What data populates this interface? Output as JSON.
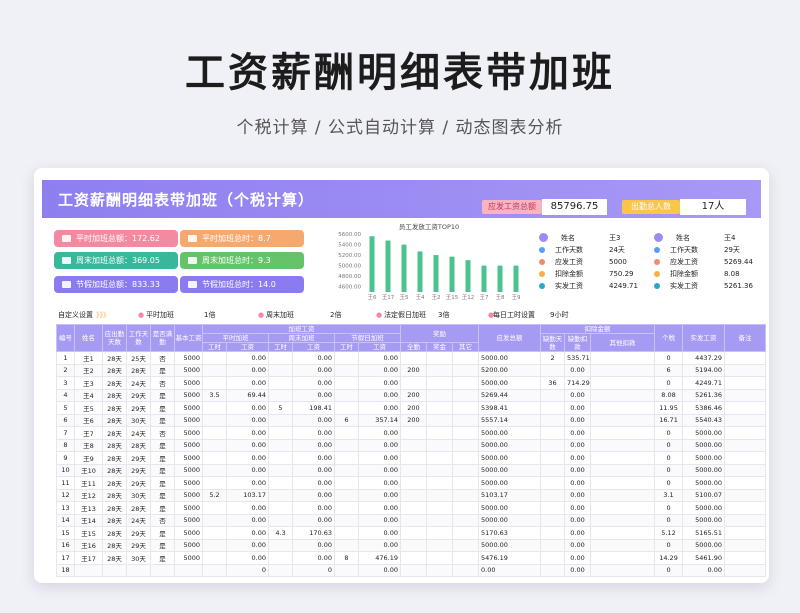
{
  "hero": {
    "title": "工资薪酬明细表带加班",
    "subtitle": "个税计算 /  公式自动计算  /  动态图表分析"
  },
  "sheet": {
    "title": "工资薪酬明细表带加班（个税计算）",
    "total_label": "应发工资总额",
    "total_value": "85796.75",
    "count_label": "出勤总人数",
    "count_value": "17人"
  },
  "kpis": [
    {
      "label": "平时加班总额：172.62",
      "color": "#f48aa0"
    },
    {
      "label": "平时加班总时：8.7",
      "color": "#f6a96f"
    },
    {
      "label": "周末加班总额：369.05",
      "color": "#37b89a"
    },
    {
      "label": "周末加班总时：9.3",
      "color": "#66c36a"
    },
    {
      "label": "节假加班总额：833.33",
      "color": "#8a7cf0"
    },
    {
      "label": "节假加班总时：14.0",
      "color": "#8a7cf0"
    }
  ],
  "chart_data": {
    "type": "bar",
    "title": "员工发放工资TOP10",
    "categories": [
      "王6",
      "王17",
      "王5",
      "王4",
      "王2",
      "王15",
      "王12",
      "王7",
      "王8",
      "王9"
    ],
    "values": [
      5557.14,
      5476.19,
      5398.41,
      5269.44,
      5200.0,
      5170.63,
      5103.17,
      5000,
      5000,
      5000
    ],
    "ylim": [
      4500,
      5600
    ],
    "yticks": [
      "5600.00",
      "5400.00",
      "5200.00",
      "5000.00",
      "4800.00",
      "4600.00"
    ],
    "color": "#4cc38f"
  },
  "emp_left": {
    "name_label": "姓名",
    "name": "王3",
    "rows": [
      {
        "k": "工作天数",
        "v": "24天",
        "c": "#5b9ef7"
      },
      {
        "k": "应发工资",
        "v": "5000",
        "c": "#f48a6a"
      },
      {
        "k": "扣除金额",
        "v": "750.29",
        "c": "#f6b04a"
      },
      {
        "k": "实发工资",
        "v": "4249.71",
        "c": "#2aa7c9"
      }
    ]
  },
  "emp_right": {
    "name_label": "姓名",
    "name": "王4",
    "rows": [
      {
        "k": "工作天数",
        "v": "29天",
        "c": "#5b9ef7"
      },
      {
        "k": "应发工资",
        "v": "5269.44",
        "c": "#f48a6a"
      },
      {
        "k": "扣除金额",
        "v": "8.08",
        "c": "#f6b04a"
      },
      {
        "k": "实发工资",
        "v": "5261.36",
        "c": "#2aa7c9"
      }
    ]
  },
  "settings": {
    "label": "自定义设置",
    "arrows": "》》》",
    "weekday": "平时加班",
    "weekday_v": "1倍",
    "weekend": "周末加班",
    "weekend_v": "2倍",
    "holiday": "法定假日加班",
    "holiday_v": "3倍",
    "hours": "每日工时设置",
    "hours_v": "9小时"
  },
  "headers": {
    "no": "编号",
    "name": "姓名",
    "due": "应出勤天数",
    "work": "工作天数",
    "full": "是否满勤",
    "base": "基本工资",
    "ot": "加班工资",
    "ot_w": "平时加班",
    "ot_e": "周末加班",
    "ot_h": "节假日加班",
    "hours": "工时",
    "pay": "工资",
    "bonus": "奖励",
    "b1": "全勤",
    "b2": "奖金",
    "b3": "其它",
    "gross": "应发总额",
    "ded": "扣除金额",
    "d1": "缺勤天数",
    "d2": "缺勤扣款",
    "d3": "其他扣款",
    "tax": "个税",
    "net": "实发工资",
    "note": "备注"
  },
  "rows": [
    [
      "1",
      "王1",
      "28天",
      "25天",
      "否",
      "5000",
      "",
      "0.00",
      "",
      "0.00",
      "",
      "0.00",
      "",
      "",
      "",
      "5000.00",
      "2",
      "535.71",
      "",
      "0",
      "4437.29",
      ""
    ],
    [
      "2",
      "王2",
      "28天",
      "28天",
      "是",
      "5000",
      "",
      "0.00",
      "",
      "0.00",
      "",
      "0.00",
      "200",
      "",
      "",
      "5200.00",
      "",
      "0.00",
      "",
      "6",
      "5194.00",
      ""
    ],
    [
      "3",
      "王3",
      "28天",
      "24天",
      "否",
      "5000",
      "",
      "0.00",
      "",
      "0.00",
      "",
      "0.00",
      "",
      "",
      "",
      "5000.00",
      "36",
      "714.29",
      "",
      "0",
      "4249.71",
      ""
    ],
    [
      "4",
      "王4",
      "28天",
      "29天",
      "是",
      "5000",
      "3.5",
      "69.44",
      "",
      "0.00",
      "",
      "0.00",
      "200",
      "",
      "",
      "5269.44",
      "",
      "0.00",
      "",
      "8.08",
      "5261.36",
      ""
    ],
    [
      "5",
      "王5",
      "28天",
      "29天",
      "是",
      "5000",
      "",
      "0.00",
      "5",
      "198.41",
      "",
      "0.00",
      "200",
      "",
      "",
      "5398.41",
      "",
      "0.00",
      "",
      "11.95",
      "5386.46",
      ""
    ],
    [
      "6",
      "王6",
      "28天",
      "30天",
      "是",
      "5000",
      "",
      "0.00",
      "",
      "0.00",
      "6",
      "357.14",
      "200",
      "",
      "",
      "5557.14",
      "",
      "0.00",
      "",
      "16.71",
      "5540.43",
      ""
    ],
    [
      "7",
      "王7",
      "28天",
      "24天",
      "否",
      "5000",
      "",
      "0.00",
      "",
      "0.00",
      "",
      "0.00",
      "",
      "",
      "",
      "5000.00",
      "",
      "0.00",
      "",
      "0",
      "5000.00",
      ""
    ],
    [
      "8",
      "王8",
      "28天",
      "28天",
      "是",
      "5000",
      "",
      "0.00",
      "",
      "0.00",
      "",
      "0.00",
      "",
      "",
      "",
      "5000.00",
      "",
      "0.00",
      "",
      "0",
      "5000.00",
      ""
    ],
    [
      "9",
      "王9",
      "28天",
      "29天",
      "是",
      "5000",
      "",
      "0.00",
      "",
      "0.00",
      "",
      "0.00",
      "",
      "",
      "",
      "5000.00",
      "",
      "0.00",
      "",
      "0",
      "5000.00",
      ""
    ],
    [
      "10",
      "王10",
      "28天",
      "29天",
      "是",
      "5000",
      "",
      "0.00",
      "",
      "0.00",
      "",
      "0.00",
      "",
      "",
      "",
      "5000.00",
      "",
      "0.00",
      "",
      "0",
      "5000.00",
      ""
    ],
    [
      "11",
      "王11",
      "28天",
      "29天",
      "是",
      "5000",
      "",
      "0.00",
      "",
      "0.00",
      "",
      "0.00",
      "",
      "",
      "",
      "5000.00",
      "",
      "0.00",
      "",
      "0",
      "5000.00",
      ""
    ],
    [
      "12",
      "王12",
      "28天",
      "30天",
      "是",
      "5000",
      "5.2",
      "103.17",
      "",
      "0.00",
      "",
      "0.00",
      "",
      "",
      "",
      "5103.17",
      "",
      "0.00",
      "",
      "3.1",
      "5100.07",
      ""
    ],
    [
      "13",
      "王13",
      "28天",
      "28天",
      "是",
      "5000",
      "",
      "0.00",
      "",
      "0.00",
      "",
      "0.00",
      "",
      "",
      "",
      "5000.00",
      "",
      "0.00",
      "",
      "0",
      "5000.00",
      ""
    ],
    [
      "14",
      "王14",
      "28天",
      "24天",
      "否",
      "5000",
      "",
      "0.00",
      "",
      "0.00",
      "",
      "0.00",
      "",
      "",
      "",
      "5000.00",
      "",
      "0.00",
      "",
      "0",
      "5000.00",
      ""
    ],
    [
      "15",
      "王15",
      "28天",
      "29天",
      "是",
      "5000",
      "",
      "0.00",
      "4.3",
      "170.63",
      "",
      "0.00",
      "",
      "",
      "",
      "5170.63",
      "",
      "0.00",
      "",
      "5.12",
      "5165.51",
      ""
    ],
    [
      "16",
      "王16",
      "28天",
      "29天",
      "是",
      "5000",
      "",
      "0.00",
      "",
      "0.00",
      "",
      "0.00",
      "",
      "",
      "",
      "5000.00",
      "",
      "0.00",
      "",
      "0",
      "5000.00",
      ""
    ],
    [
      "17",
      "王17",
      "28天",
      "30天",
      "是",
      "5000",
      "",
      "0.00",
      "",
      "0.00",
      "8",
      "476.19",
      "",
      "",
      "",
      "5476.19",
      "",
      "0.00",
      "",
      "14.29",
      "5461.90",
      ""
    ],
    [
      "18",
      "",
      "",
      "",
      "",
      "",
      "",
      "0",
      "",
      "0",
      "",
      "0.00",
      "",
      "",
      "",
      "0.00",
      "",
      "0.00",
      "",
      "0",
      "0.00",
      ""
    ]
  ]
}
